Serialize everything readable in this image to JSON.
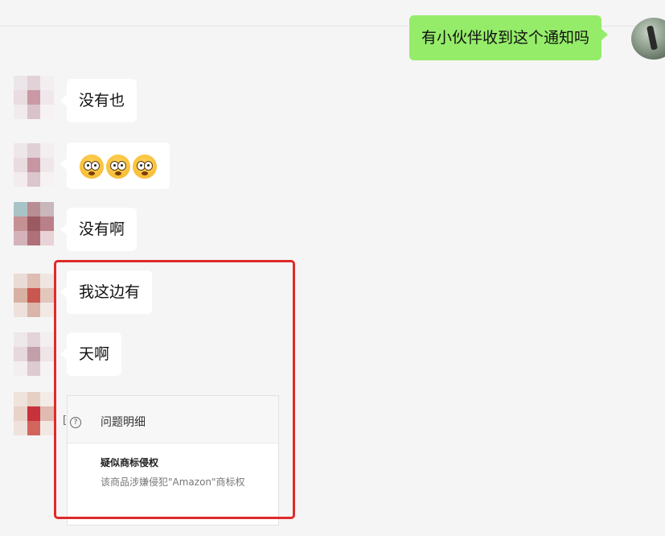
{
  "chat": {
    "outgoing": {
      "text": "有小伙伴收到这个通知吗"
    },
    "messages": [
      {
        "text": "没有也"
      },
      {
        "emojis": [
          "flushed-face",
          "flushed-face",
          "flushed-face"
        ]
      },
      {
        "text": "没有啊"
      },
      {
        "text": "我这边有"
      },
      {
        "text": "天啊"
      }
    ],
    "card": {
      "cut_char": "[",
      "info_symbol": "?",
      "header": "问题明细",
      "item_title": "疑似商标侵权",
      "item_desc": "该商品涉嫌侵犯\"Amazon\"商标权"
    }
  },
  "colors": {
    "outgoing_bubble": "#95ec69",
    "incoming_bubble": "#ffffff",
    "background": "#f5f5f5",
    "highlight_border": "#e02a2a"
  }
}
